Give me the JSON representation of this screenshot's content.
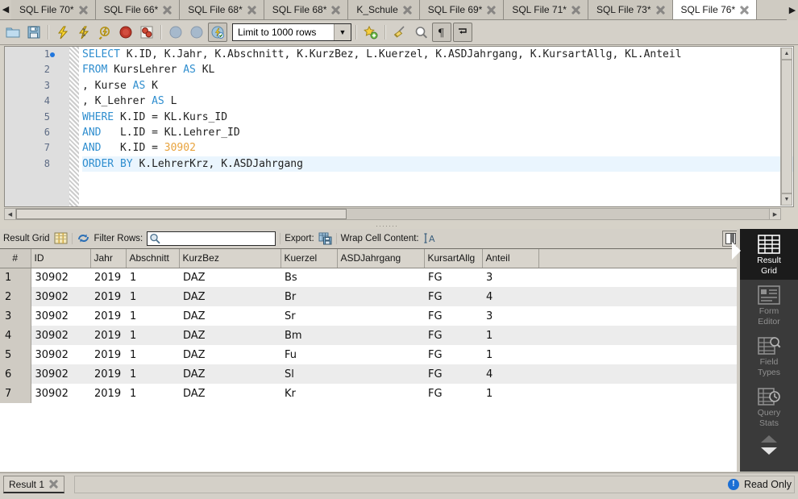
{
  "window": {
    "app": "MySQL Workbench SQL Editor"
  },
  "tabbar": {
    "scroll_left_icon": "triangle-left-icon",
    "scroll_right_icon": "triangle-right-icon",
    "tabs": [
      {
        "label": "SQL File 70*",
        "active": false
      },
      {
        "label": "SQL File 66*",
        "active": false
      },
      {
        "label": "SQL File 68*",
        "active": false
      },
      {
        "label": "SQL File 68*",
        "active": false
      },
      {
        "label": "K_Schule",
        "active": false
      },
      {
        "label": "SQL File 69*",
        "active": false
      },
      {
        "label": "SQL File 71*",
        "active": false
      },
      {
        "label": "SQL File 73*",
        "active": false
      },
      {
        "label": "SQL File 76*",
        "active": true
      }
    ]
  },
  "toolbar": {
    "buttons": [
      {
        "name": "open-sql-script-button",
        "icon": "folder-icon"
      },
      {
        "name": "save-sql-script-button",
        "icon": "floppy-disk-icon"
      },
      {
        "name": "execute-statement-button",
        "icon": "lightning-icon"
      },
      {
        "name": "execute-current-button",
        "icon": "lightning-cursor-icon"
      },
      {
        "name": "explain-plan-button",
        "icon": "magnifier-lightning-icon"
      },
      {
        "name": "stop-execution-button",
        "icon": "stop-circle-icon"
      },
      {
        "name": "toggle-stop-on-error-button",
        "icon": "stop-on-error-icon"
      },
      {
        "name": "commit-button",
        "icon": "commit-icon"
      },
      {
        "name": "rollback-button",
        "icon": "rollback-icon"
      },
      {
        "name": "toggle-autocommit-button",
        "icon": "autocommit-icon"
      }
    ],
    "limit_rows": {
      "value": "Limit to 1000 rows",
      "chevron_icon": "chevron-down-icon"
    },
    "right_buttons": [
      {
        "name": "new-snippet-button",
        "icon": "star-plus-icon"
      },
      {
        "name": "clear-query-button",
        "icon": "broom-icon"
      },
      {
        "name": "find-button",
        "icon": "magnifier-icon"
      },
      {
        "name": "toggle-invisible-button",
        "icon": "pilcrow-icon"
      },
      {
        "name": "toggle-wrapping-button",
        "icon": "wrap-arrow-icon"
      }
    ]
  },
  "editor": {
    "breakpoint_line": 1,
    "lines": [
      {
        "n": "1",
        "highlight": false,
        "tokens": [
          {
            "t": "SELECT",
            "c": "kw"
          },
          {
            "t": " K.ID, K.Jahr, K.Abschnitt, K.KurzBez, L.Kuerzel, K.ASDJahrgang, K.KursartAllg, KL.Anteil",
            "c": "pl"
          }
        ]
      },
      {
        "n": "2",
        "highlight": false,
        "tokens": [
          {
            "t": "FROM",
            "c": "kw"
          },
          {
            "t": " KursLehrer ",
            "c": "pl"
          },
          {
            "t": "AS",
            "c": "kw"
          },
          {
            "t": " KL",
            "c": "pl"
          }
        ]
      },
      {
        "n": "3",
        "highlight": false,
        "tokens": [
          {
            "t": ", Kurse ",
            "c": "pl"
          },
          {
            "t": "AS",
            "c": "kw"
          },
          {
            "t": " K",
            "c": "pl"
          }
        ]
      },
      {
        "n": "4",
        "highlight": false,
        "tokens": [
          {
            "t": ", K_Lehrer ",
            "c": "pl"
          },
          {
            "t": "AS",
            "c": "kw"
          },
          {
            "t": " L",
            "c": "pl"
          }
        ]
      },
      {
        "n": "5",
        "highlight": false,
        "tokens": [
          {
            "t": "WHERE",
            "c": "kw"
          },
          {
            "t": " K.ID = KL.Kurs_ID",
            "c": "pl"
          }
        ]
      },
      {
        "n": "6",
        "highlight": false,
        "tokens": [
          {
            "t": "AND",
            "c": "kw"
          },
          {
            "t": "   L.ID = KL.Lehrer_ID",
            "c": "pl"
          }
        ]
      },
      {
        "n": "7",
        "highlight": false,
        "tokens": [
          {
            "t": "AND",
            "c": "kw"
          },
          {
            "t": "   K.ID = ",
            "c": "pl"
          },
          {
            "t": "30902",
            "c": "num"
          }
        ]
      },
      {
        "n": "8",
        "highlight": true,
        "tokens": [
          {
            "t": "ORDER",
            "c": "kw"
          },
          {
            "t": " BY",
            "c": "kw"
          },
          {
            "t": " K.LehrerKrz, K.ASDJahrgang",
            "c": "pl"
          }
        ]
      }
    ]
  },
  "result_toolbar": {
    "result_grid_label": "Result Grid",
    "result_grid_icon": "grid-icon",
    "refresh_icon": "refresh-icon",
    "filter_rows_label": "Filter Rows:",
    "filter_value": "",
    "filter_placeholder": "",
    "search_icon": "search-icon",
    "export_label": "Export:",
    "export_icon": "export-grid-icon",
    "wrap_cell_label": "Wrap Cell Content:",
    "wrap_cell_icon": "wrap-text-icon",
    "panel_toggle_icon": "panel-toggle-icon"
  },
  "grid": {
    "columns": [
      "#",
      "ID",
      "Jahr",
      "Abschnitt",
      "KurzBez",
      "Kuerzel",
      "ASDJahrgang",
      "KursartAllg",
      "Anteil",
      ""
    ],
    "rows": [
      {
        "n": "1",
        "cells": [
          "30902",
          "2019",
          "1",
          "DAZ",
          "Bs",
          "",
          "FG",
          "3",
          ""
        ]
      },
      {
        "n": "2",
        "cells": [
          "30902",
          "2019",
          "1",
          "DAZ",
          "Br",
          "",
          "FG",
          "4",
          ""
        ]
      },
      {
        "n": "3",
        "cells": [
          "30902",
          "2019",
          "1",
          "DAZ",
          "Sr",
          "",
          "FG",
          "3",
          ""
        ]
      },
      {
        "n": "4",
        "cells": [
          "30902",
          "2019",
          "1",
          "DAZ",
          "Bm",
          "",
          "FG",
          "1",
          ""
        ]
      },
      {
        "n": "5",
        "cells": [
          "30902",
          "2019",
          "1",
          "DAZ",
          "Fu",
          "",
          "FG",
          "1",
          ""
        ]
      },
      {
        "n": "6",
        "cells": [
          "30902",
          "2019",
          "1",
          "DAZ",
          "Sl",
          "",
          "FG",
          "4",
          ""
        ]
      },
      {
        "n": "7",
        "cells": [
          "30902",
          "2019",
          "1",
          "DAZ",
          "Kr",
          "",
          "FG",
          "1",
          ""
        ]
      }
    ]
  },
  "sidepanel": {
    "items": [
      {
        "label_line1": "Result",
        "label_line2": "Grid",
        "icon": "result-grid-icon",
        "active": true
      },
      {
        "label_line1": "Form",
        "label_line2": "Editor",
        "icon": "form-editor-icon",
        "active": false
      },
      {
        "label_line1": "Field",
        "label_line2": "Types",
        "icon": "field-types-icon",
        "active": false
      },
      {
        "label_line1": "Query",
        "label_line2": "Stats",
        "icon": "query-stats-icon",
        "active": false
      }
    ],
    "scroll_up_icon": "chevron-up-icon",
    "scroll_down_icon": "chevron-down-icon"
  },
  "bottom": {
    "result_tab_label": "Result 1",
    "status_text": "Read Only",
    "status_icon": "info-icon"
  },
  "colors": {
    "chrome": "#d4d0c8",
    "active_tab": "#ffffff",
    "keyword": "#2f8ecf",
    "number": "#e8a33d",
    "panel_dark": "#3a3a3a",
    "panel_active": "#1b1b1b",
    "row_alt": "#ececec",
    "highlight_line": "#eaf5fe",
    "info_blue": "#1c6fd4"
  }
}
